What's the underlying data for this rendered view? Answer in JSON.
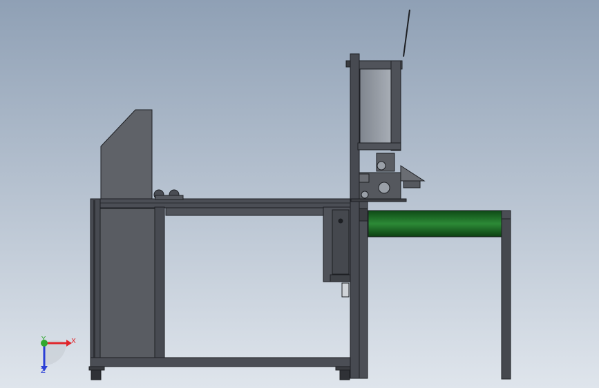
{
  "colors": {
    "background_top": "#8fa0b5",
    "background_bottom": "#dfe5ec",
    "frame": "#4a4d54",
    "frame_edge": "#1d1f23",
    "panel": "#5a5d63",
    "glass": "#9aa0a8",
    "conveyor_belt": "#1f7a2a",
    "axis_x": "#e0242a",
    "axis_y": "#2fa82f",
    "axis_z": "#2a3fd6"
  },
  "icons": {
    "triad": "coordinate-triad-icon"
  },
  "triad": {
    "x_label": "X",
    "y_label": "Y",
    "z_label": "Z"
  }
}
